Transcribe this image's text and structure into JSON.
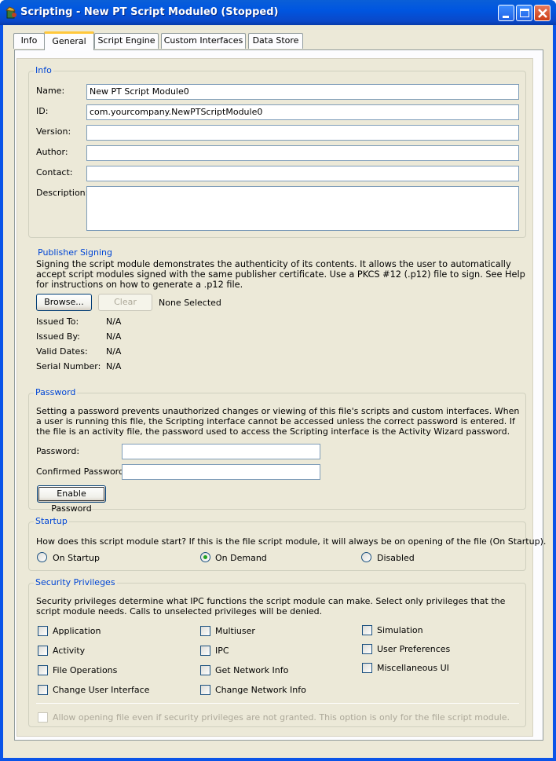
{
  "window": {
    "title": "Scripting - New PT Script Module0 (Stopped)"
  },
  "tabs": [
    {
      "label": "Info"
    },
    {
      "label": "General"
    },
    {
      "label": "Script Engine"
    },
    {
      "label": "Custom Interfaces"
    },
    {
      "label": "Data Store"
    }
  ],
  "info": {
    "legend": "Info",
    "name_label": "Name:",
    "name_value": "New PT Script Module0",
    "id_label": "ID:",
    "id_value": "com.yourcompany.NewPTScriptModule0",
    "version_label": "Version:",
    "version_value": "",
    "author_label": "Author:",
    "author_value": "",
    "contact_label": "Contact:",
    "contact_value": "",
    "description_label": "Description:",
    "description_value": ""
  },
  "publisher": {
    "legend": "Publisher Signing",
    "description": "Signing the script module demonstrates the authenticity of its contents. It allows the user to automatically accept script modules signed with the same publisher certificate. Use a PKCS #12 (.p12) file to sign. See Help for instructions on how to generate a .p12 file.",
    "browse_label": "Browse...",
    "clear_label": "Clear",
    "selected_text": "None Selected",
    "issued_to_label": "Issued To:",
    "issued_to_value": "N/A",
    "issued_by_label": "Issued By:",
    "issued_by_value": "N/A",
    "valid_dates_label": "Valid Dates:",
    "valid_dates_value": "N/A",
    "serial_label": "Serial Number:",
    "serial_value": "N/A"
  },
  "password": {
    "legend": "Password",
    "description": "Setting a password prevents unauthorized changes or viewing of this file's scripts and custom interfaces. When a user is running this file, the Scripting interface cannot be accessed unless the correct password is entered.  If the file is an activity file, the password used to access the Scripting interface is the Activity Wizard password.",
    "password_label": "Password:",
    "confirm_label": "Confirmed Password:",
    "enable_label": "Enable Password"
  },
  "startup": {
    "legend": "Startup",
    "description": "How does this script module start?  If this is the file script module, it will always be on opening of the file (On Startup).",
    "options": [
      {
        "label": "On Startup",
        "selected": false
      },
      {
        "label": "On Demand",
        "selected": true
      },
      {
        "label": "Disabled",
        "selected": false
      }
    ]
  },
  "security": {
    "legend": "Security Privileges",
    "description": "Security privileges determine what IPC functions the script module can make. Select only privileges that the script module needs. Calls to unselected privileges will be denied.",
    "privileges": [
      {
        "label": "Application",
        "checked": false
      },
      {
        "label": "Activity",
        "checked": false
      },
      {
        "label": "File Operations",
        "checked": false
      },
      {
        "label": "Change User Interface",
        "checked": false
      },
      {
        "label": "Multiuser",
        "checked": false
      },
      {
        "label": "IPC",
        "checked": false
      },
      {
        "label": "Get Network Info",
        "checked": false
      },
      {
        "label": "Change Network Info",
        "checked": false
      },
      {
        "label": "Simulation",
        "checked": false
      },
      {
        "label": "User Preferences",
        "checked": false
      },
      {
        "label": "Miscellaneous UI",
        "checked": false
      }
    ],
    "allow_label": "Allow opening file even if security privileges are not granted. This option is only for the file script module."
  }
}
